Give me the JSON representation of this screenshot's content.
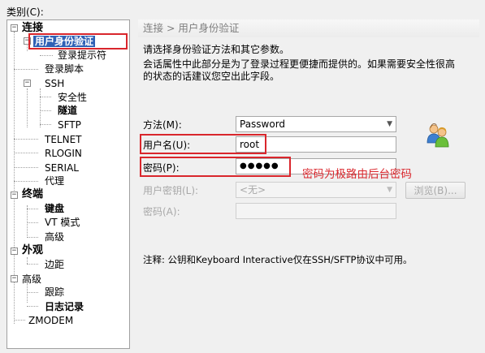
{
  "category_label": "类别(C):",
  "tree": {
    "connection": "连接",
    "auth": "用户身份验证",
    "login_prompts": "登录提示符",
    "login_script": "登录脚本",
    "ssh": "SSH",
    "security": "安全性",
    "tunnel": "隧道",
    "sftp": "SFTP",
    "telnet": "TELNET",
    "rlogin": "RLOGIN",
    "serial": "SERIAL",
    "proxy": "代理",
    "terminal": "终端",
    "keyboard": "键盘",
    "vt_mode": "VT 模式",
    "advanced1": "高级",
    "appearance": "外观",
    "margin": "边距",
    "advanced2": "高级",
    "trace": "跟踪",
    "logging": "日志记录",
    "zmodem": "ZMODEM"
  },
  "header": {
    "title": "连接 > 用户身份验证"
  },
  "description": {
    "line1": "请选择身份验证方法和其它参数。",
    "line2": "会话属性中此部分是为了登录过程更便捷而提供的。如果需要安全性很高",
    "line3": "的状态的话建议您空出此字段。"
  },
  "form": {
    "method_label": "方法(M):",
    "method_value": "Password",
    "username_label": "用户名(U):",
    "username_value": "root",
    "password_label": "密码(P):",
    "password_value": "●●●●●",
    "user_key_label": "用户密钥(L):",
    "user_key_value": "<无>",
    "browse_label": "浏览(B)...",
    "passphrase_label": "密码(A):"
  },
  "annotation": "密码为极路由后台密码",
  "note": "注释: 公钥和Keyboard Interactive仅在SSH/SFTP协议中可用。",
  "colors": {
    "highlight": "#d9262c",
    "selected_bg": "#2f61b5"
  },
  "icons": {
    "users": "users-icon"
  }
}
